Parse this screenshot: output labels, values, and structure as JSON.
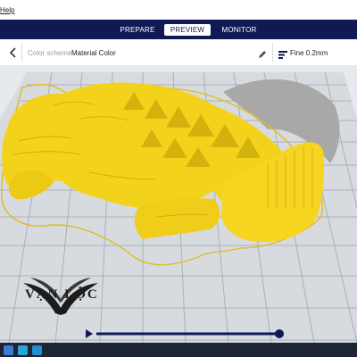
{
  "menubar": {
    "help_label": "Help"
  },
  "stages": [
    {
      "label": "PREPARE",
      "active": false
    },
    {
      "label": "PREVIEW",
      "active": true
    },
    {
      "label": "MONITOR",
      "active": false
    }
  ],
  "toolbar": {
    "color_scheme_label": "Color scheme",
    "color_scheme_value": "Material Color",
    "profile_value": "Fine 0.2mm"
  },
  "logo": {
    "name": "VẠN LỘC",
    "tagline": ""
  },
  "colors": {
    "stage_bar": "#0f1a54",
    "model_fill": "#f3d21c",
    "model_shadow": "#a7a7a7",
    "plate": "#d9dde2",
    "grid": "#a9b0b9",
    "playhead": "#0f1a54"
  },
  "icons": {
    "back": "chevron-left-icon",
    "edit": "pencil-icon",
    "profile": "layers-icon",
    "play": "play-icon"
  }
}
